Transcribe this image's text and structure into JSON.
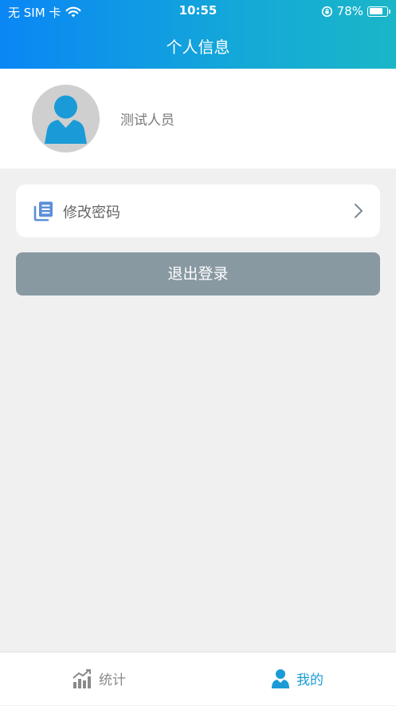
{
  "status_bar": {
    "carrier": "无 SIM 卡",
    "time": "10:55",
    "battery": "78%",
    "battery_level": 0.78,
    "icons": [
      "wifi-icon",
      "orientation-lock-icon",
      "battery-icon"
    ]
  },
  "header": {
    "title": "个人信息"
  },
  "profile": {
    "name": "测试人员",
    "avatar_icon": "user-avatar-icon"
  },
  "menu": {
    "change_password": "修改密码",
    "icon": "document-list-icon"
  },
  "logout": {
    "label": "退出登录"
  },
  "tabbar": {
    "tabs": [
      {
        "label": "统计",
        "icon": "chart-icon",
        "active": false
      },
      {
        "label": "我的",
        "icon": "person-icon",
        "active": true
      }
    ]
  },
  "colors": {
    "header_start": "#0a86f5",
    "header_end": "#1ab6c8",
    "accent": "#1a9bd7",
    "logout_bg": "#8899a2",
    "inactive_tab": "#8a8a8a",
    "background": "#f0f0f0"
  }
}
